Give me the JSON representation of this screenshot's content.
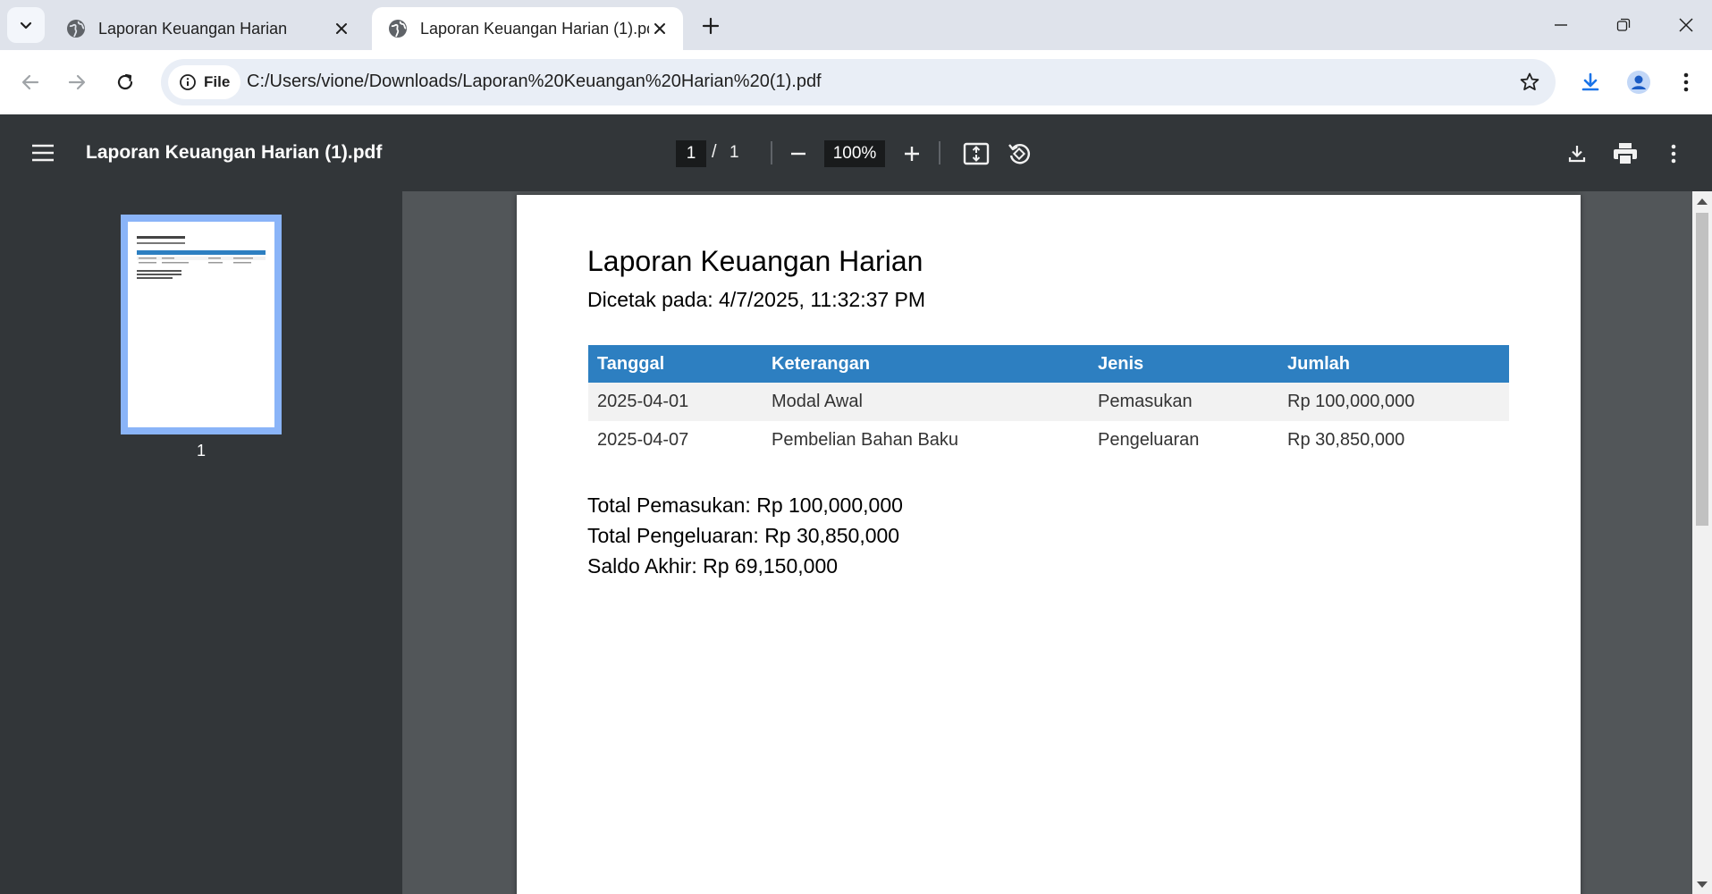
{
  "browser": {
    "tabs": [
      {
        "title": "Laporan Keuangan Harian",
        "active": false
      },
      {
        "title": "Laporan Keuangan Harian (1).pdf",
        "active": true
      }
    ],
    "omnibox": {
      "chip_label": "File",
      "url": "C:/Users/vione/Downloads/Laporan%20Keuangan%20Harian%20(1).pdf"
    }
  },
  "viewer": {
    "doc_title": "Laporan Keuangan Harian (1).pdf",
    "current_page": "1",
    "page_separator": "/",
    "total_pages": "1",
    "zoom": "100%",
    "thumbnail_label": "1"
  },
  "document": {
    "title": "Laporan Keuangan Harian",
    "printed": "Dicetak pada: 4/7/2025, 11:32:37 PM",
    "table": {
      "headers": [
        "Tanggal",
        "Keterangan",
        "Jenis",
        "Jumlah"
      ],
      "rows": [
        [
          "2025-04-01",
          "Modal Awal",
          "Pemasukan",
          "Rp 100,000,000"
        ],
        [
          "2025-04-07",
          "Pembelian Bahan Baku",
          "Pengeluaran",
          "Rp 30,850,000"
        ]
      ]
    },
    "totals": {
      "income": "Total Pemasukan: Rp 100,000,000",
      "expense": "Total Pengeluaran: Rp 30,850,000",
      "balance": "Saldo Akhir: Rp 69,150,000"
    }
  },
  "colors": {
    "table_header": "#2d7fc1",
    "viewer_toolbar": "#323639",
    "viewer_background": "#525659",
    "thumbnail_highlight": "#8ab4f8"
  },
  "icons": [
    "tab-search-icon",
    "globe-icon",
    "close-icon",
    "plus-icon",
    "minimize-icon",
    "restore-icon",
    "back-arrow-icon",
    "forward-arrow-icon",
    "reload-icon",
    "info-icon",
    "star-icon",
    "download-icon",
    "profile-icon",
    "more-vert-icon",
    "hamburger-menu-icon",
    "zoom-out-icon",
    "zoom-in-icon",
    "fit-page-icon",
    "rotate-icon",
    "print-icon"
  ]
}
